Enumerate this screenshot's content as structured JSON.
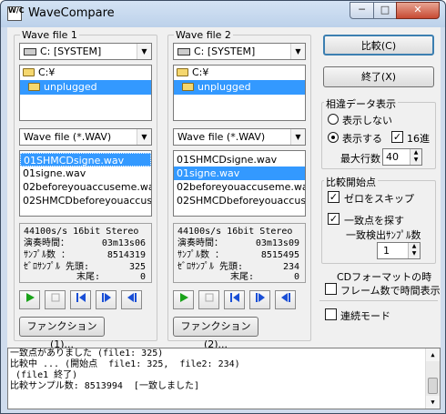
{
  "window": {
    "title": "WaveCompare",
    "icon_text": "W/C"
  },
  "titlebar": {
    "minimize": "─",
    "maximize": "□",
    "close": "✕"
  },
  "panel1": {
    "group_label": "Wave file 1",
    "drive": "C: [SYSTEM]",
    "dirs": [
      "C:¥",
      "unplugged"
    ],
    "filter": "Wave file (*.WAV)",
    "files": [
      "01SHMCDsigne.wav",
      "01signe.wav",
      "02beforeyouaccuseme.wav",
      "02SHMCDbeforeyouaccuse"
    ],
    "selected_file": 0,
    "info": {
      "format": "44100s/s 16bit Stereo",
      "duration_label": "演奏時間：",
      "duration": "03m13s06",
      "samples_label": "ｻﾝﾌﾟﾙ数 ：",
      "samples": "8514319",
      "zero_label": "ｾﾞﾛｻﾝﾌﾟﾙ 先頭:",
      "zero_head": "325",
      "tail_label": "末尾:",
      "zero_tail": "0"
    },
    "function_button": "ファンクション(1)..."
  },
  "panel2": {
    "group_label": "Wave file 2",
    "drive": "C: [SYSTEM]",
    "dirs": [
      "C:¥",
      "unplugged"
    ],
    "filter": "Wave file (*.WAV)",
    "files": [
      "01SHMCDsigne.wav",
      "01signe.wav",
      "02beforeyouaccuseme.wav",
      "02SHMCDbeforeyouaccuse"
    ],
    "selected_file": 1,
    "info": {
      "format": "44100s/s 16bit Stereo",
      "duration_label": "演奏時間：",
      "duration": "03m13s09",
      "samples_label": "ｻﾝﾌﾟﾙ数 ：",
      "samples": "8515495",
      "zero_label": "ｾﾞﾛｻﾝﾌﾟﾙ 先頭:",
      "zero_head": "234",
      "tail_label": "末尾:",
      "zero_tail": "0"
    },
    "function_button": "ファンクション(2)..."
  },
  "actions": {
    "compare": "比較(C)",
    "exit": "終了(X)"
  },
  "diff_display": {
    "label": "相違データ表示",
    "hide": "表示しない",
    "show": "表示する",
    "hex": "16進",
    "max_lines_label": "最大行数",
    "max_lines": "40"
  },
  "compare_start": {
    "label": "比較開始点",
    "skip_zero": "ゼロをスキップ",
    "find_match": "一致点を探す",
    "match_samples_label": "一致検出ｻﾝﾌﾟﾙ数",
    "match_samples": "1"
  },
  "cd_format": {
    "label": "CDフォーマットの時",
    "frames": "フレーム数で時間表示"
  },
  "continuous_mode": "連続モード",
  "log": [
    "一致点がありました (file1: 325)",
    "比較中 ... (開始点  file1: 325,  file2: 234)",
    " (file1 終了)",
    "比較サンプル数: 8513994  [一致しました]"
  ],
  "colors": {
    "selection": "#3399ff",
    "play_green": "#1aa31a",
    "transport_blue": "#1a4fd6"
  }
}
